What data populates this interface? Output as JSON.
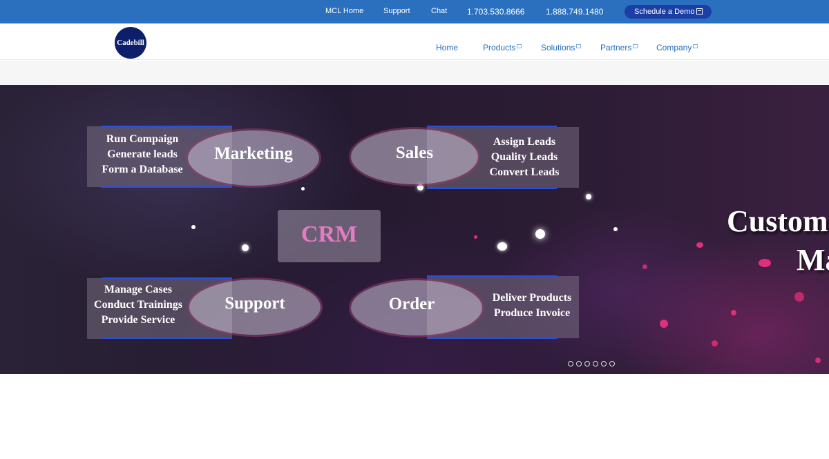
{
  "topbar": {
    "mcl_home": "MCL Home",
    "support": "Support",
    "chat": "Chat",
    "phone1": "1.703.530.8666",
    "phone2": "1.888.749.1480",
    "demo_label": "Schedule a Demo"
  },
  "logo": {
    "text": "Cadebill"
  },
  "nav": {
    "home": "Home",
    "products": "Products",
    "solutions": "Solutions",
    "partners": "Partners",
    "company": "Company"
  },
  "hero": {
    "center": "CRM",
    "marketing": {
      "label": "Marketing",
      "lines": [
        "Run Compaign",
        "Generate leads",
        "Form a Database"
      ]
    },
    "sales": {
      "label": "Sales",
      "lines": [
        "Assign Leads",
        "Quality Leads",
        "Convert Leads"
      ]
    },
    "support": {
      "label": "Support",
      "lines": [
        "Manage Cases",
        "Conduct Trainings",
        "Provide Service"
      ]
    },
    "order": {
      "label": "Order",
      "lines": [
        "Deliver Products",
        "Produce Invoice"
      ]
    },
    "headline_line1": "Custom",
    "headline_line2": "Ma",
    "slide_count": 6,
    "colors": {
      "topbar": "#2b70bf",
      "demo_button": "#1b3fa6",
      "nav_link": "#2070c4",
      "crm_text": "#e57bc1"
    }
  }
}
